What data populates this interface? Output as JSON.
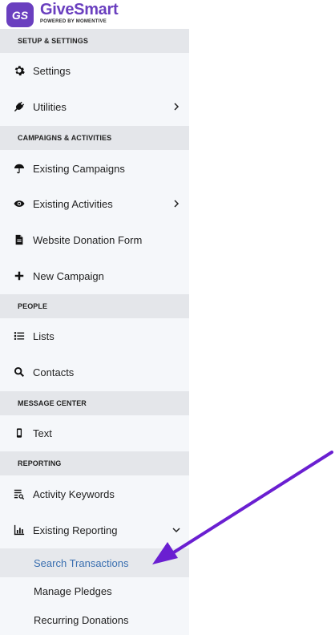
{
  "brand": {
    "badge": "GS",
    "name": "GiveSmart",
    "tagline": "POWERED BY MOMENTIVE",
    "color": "#6a3fbf"
  },
  "sections": {
    "setup": "SETUP & SETTINGS",
    "campaigns": "CAMPAIGNS & ACTIVITIES",
    "people": "PEOPLE",
    "message": "MESSAGE CENTER",
    "reporting": "REPORTING"
  },
  "items": {
    "settings": {
      "label": "Settings",
      "icon": "gear-icon"
    },
    "utilities": {
      "label": "Utilities",
      "icon": "plug-icon"
    },
    "existing_campaigns": {
      "label": "Existing Campaigns",
      "icon": "umbrella-icon"
    },
    "existing_activities": {
      "label": "Existing Activities",
      "icon": "eye-icon"
    },
    "website_donation_form": {
      "label": "Website Donation Form",
      "icon": "document-icon"
    },
    "new_campaign": {
      "label": "New Campaign",
      "icon": "plus-icon"
    },
    "lists": {
      "label": "Lists",
      "icon": "list-icon"
    },
    "contacts": {
      "label": "Contacts",
      "icon": "search-icon"
    },
    "text": {
      "label": "Text",
      "icon": "mobile-icon"
    },
    "activity_keywords": {
      "label": "Activity Keywords",
      "icon": "keyword-report-icon"
    },
    "existing_reporting": {
      "label": "Existing Reporting",
      "icon": "bar-chart-icon"
    }
  },
  "reporting_subitems": {
    "search_transactions": "Search Transactions",
    "manage_pledges": "Manage Pledges",
    "recurring_donations": "Recurring Donations"
  },
  "colors": {
    "annotation_arrow": "#6a1fd1",
    "active_link": "#3a6fb0"
  }
}
